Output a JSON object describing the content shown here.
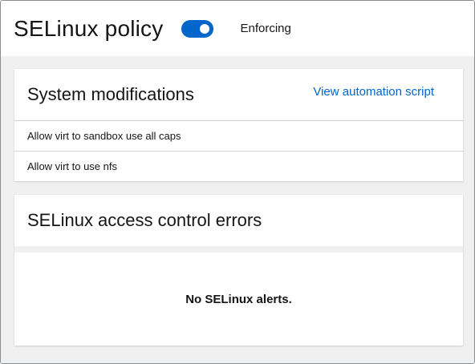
{
  "header": {
    "title": "SELinux policy",
    "toggle": {
      "state": "on",
      "label": "Enforcing"
    }
  },
  "modifications": {
    "title": "System modifications",
    "link_label": "View automation script",
    "items": [
      {
        "label": "Allow virt to sandbox use all caps"
      },
      {
        "label": "Allow virt to use nfs"
      }
    ]
  },
  "errors": {
    "title": "SELinux access control errors",
    "empty_message": "No SELinux alerts."
  },
  "colors": {
    "accent": "#0066cc",
    "page_background": "#f0f0f0",
    "text": "#151515",
    "divider": "#d2d2d2"
  }
}
